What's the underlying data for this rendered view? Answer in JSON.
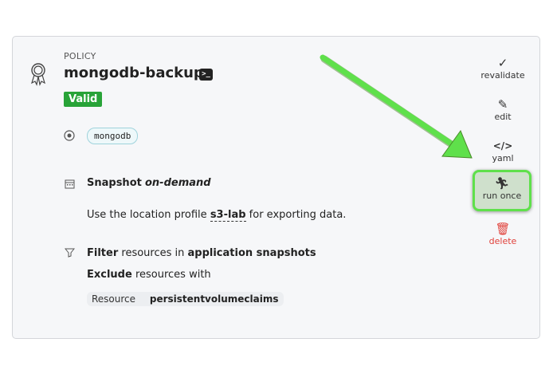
{
  "policy": {
    "kind_label": "POLICY",
    "name": "mongodb-backup",
    "status": "Valid",
    "namespace_chip": "mongodb"
  },
  "snapshot": {
    "title_bold": "Snapshot",
    "title_italic": "on-demand",
    "desc_pre": "Use the location profile",
    "profile": "s3-lab",
    "desc_post": "for exporting data."
  },
  "filter": {
    "line1_bold1": "Filter",
    "line1_mid": "resources in",
    "line1_bold2": "application snapshots",
    "line2_bold": "Exclude",
    "line2_rest": "resources with",
    "resource_key": "Resource",
    "resource_value": "persistentvolumeclaims"
  },
  "actions": {
    "revalidate": "revalidate",
    "edit": "edit",
    "yaml": "yaml",
    "run_once": "run once",
    "delete": "delete"
  },
  "colors": {
    "valid": "#28a338",
    "delete": "#e0403a",
    "highlight": "#5fe04b"
  }
}
